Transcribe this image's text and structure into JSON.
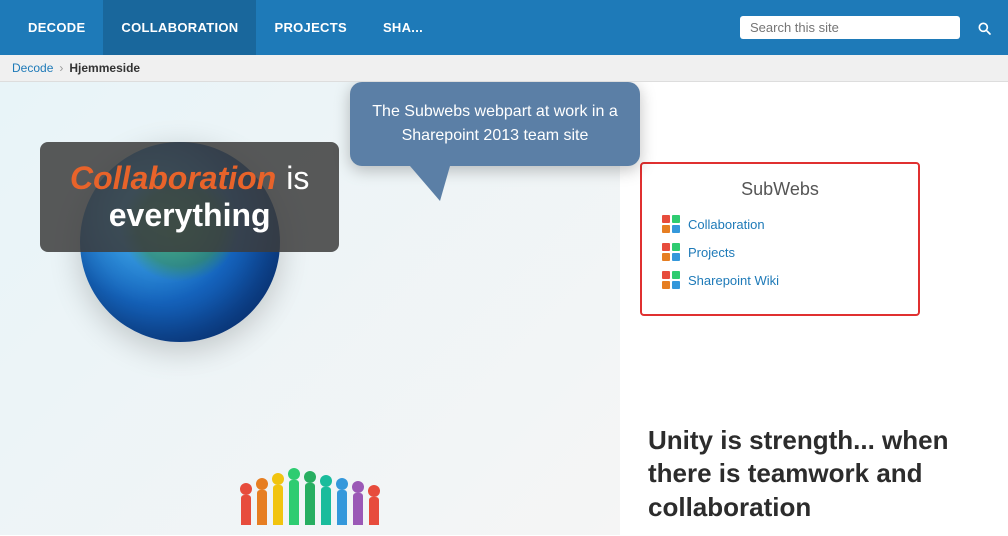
{
  "nav": {
    "items": [
      {
        "label": "DECODE",
        "id": "decode"
      },
      {
        "label": "COLLABORATION",
        "id": "collaboration",
        "active": true
      },
      {
        "label": "PROJECTS",
        "id": "projects"
      },
      {
        "label": "SHA...",
        "id": "sha"
      }
    ]
  },
  "search": {
    "placeholder": "Search this site",
    "label": "Search this site"
  },
  "breadcrumb": {
    "parent": "Decode",
    "current": "Hjemmeside"
  },
  "tooltip": {
    "text": "The Subwebs webpart at work in a Sharepoint 2013 team site"
  },
  "subwebs": {
    "title": "SubWebs",
    "links": [
      {
        "label": "Collaboration",
        "colors": [
          "#e74c3c",
          "#2ecc71",
          "#e67e22",
          "#3498db"
        ]
      },
      {
        "label": "Projects",
        "colors": [
          "#e74c3c",
          "#2ecc71",
          "#e67e22",
          "#3498db"
        ]
      },
      {
        "label": "Sharepoint Wiki",
        "colors": [
          "#e74c3c",
          "#2ecc71",
          "#e67e22",
          "#3498db"
        ]
      }
    ]
  },
  "hero": {
    "line1_colored": "Collaboration",
    "line1_rest": " is",
    "line2": "everything"
  },
  "quote": {
    "text": "Unity is strength... when there is teamwork and collaboration"
  }
}
